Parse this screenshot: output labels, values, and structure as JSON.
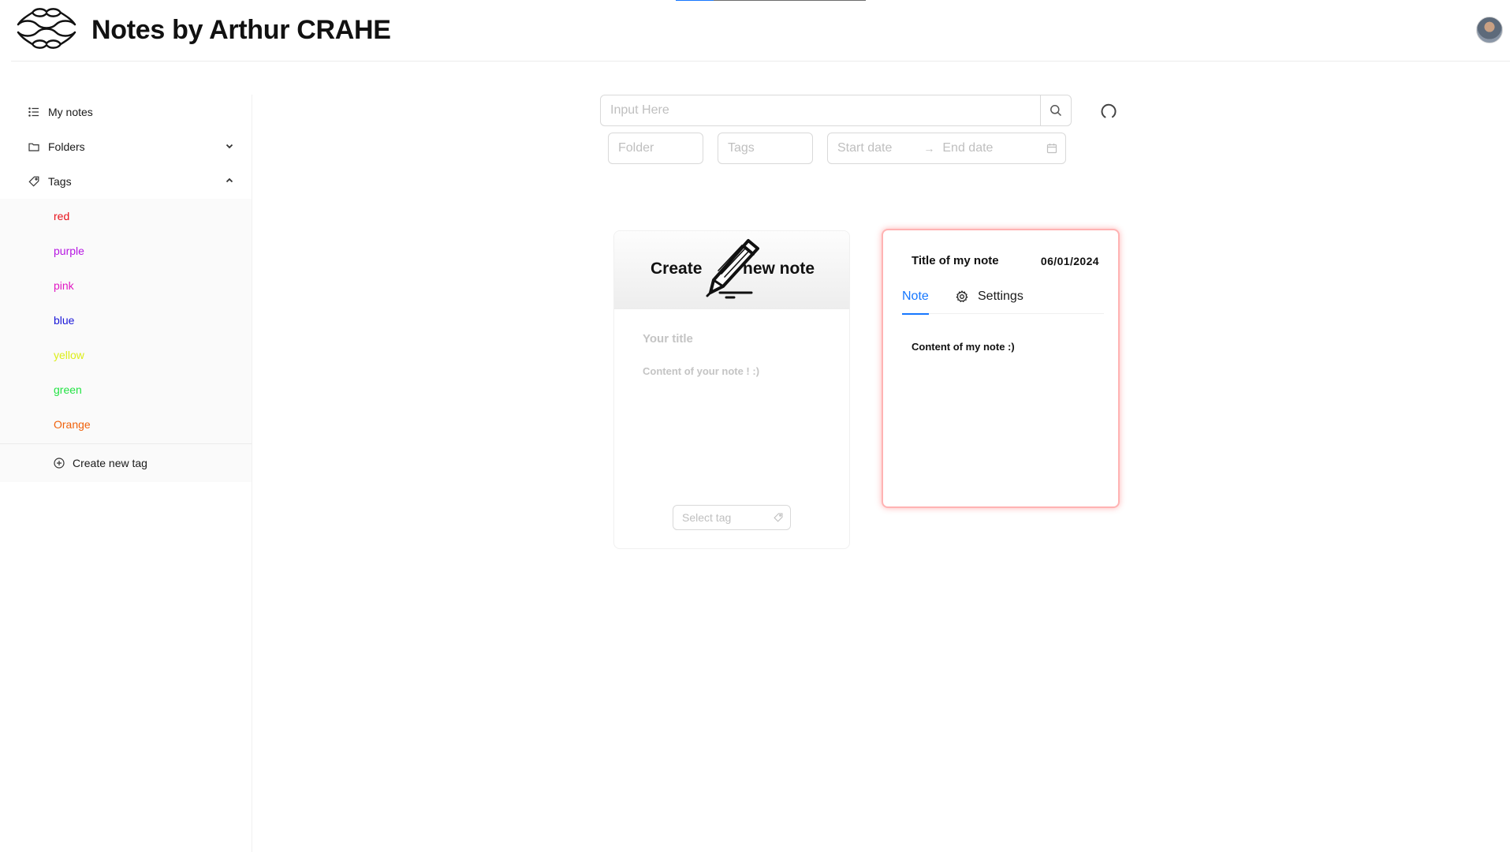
{
  "header": {
    "title": "Notes by Arthur CRAHE",
    "avatar_label": "User avatar"
  },
  "sidebar": {
    "items": [
      {
        "label": "My notes",
        "icon": "list-icon"
      },
      {
        "label": "Folders",
        "icon": "folder-icon",
        "expanded": false
      },
      {
        "label": "Tags",
        "icon": "tag-icon",
        "expanded": true
      }
    ],
    "tags": [
      {
        "label": "red",
        "color": "#e8121b"
      },
      {
        "label": "purple",
        "color": "#b617e2"
      },
      {
        "label": "pink",
        "color": "#e019c3"
      },
      {
        "label": "blue",
        "color": "#1a17d8"
      },
      {
        "label": "yellow",
        "color": "#dcee1a"
      },
      {
        "label": "green",
        "color": "#23e344"
      },
      {
        "label": "Orange",
        "color": "#f0620c"
      }
    ],
    "create_tag_label": "Create new tag"
  },
  "search": {
    "placeholder": "Input Here",
    "value": "",
    "folder_placeholder": "Folder",
    "tags_placeholder": "Tags",
    "start_date_placeholder": "Start date",
    "end_date_placeholder": "End date"
  },
  "create_card": {
    "banner_word_1": "Create",
    "banner_word_2": "new note",
    "title_placeholder": "Your title",
    "content_placeholder": "Content of your note ! :)",
    "select_tag_placeholder": "Select tag"
  },
  "note_card": {
    "title": "Title of my note",
    "date": "06/01/2024",
    "tabs": [
      {
        "label": "Note",
        "active": true
      },
      {
        "label": "Settings",
        "active": false
      }
    ],
    "content": "Content of my note :)",
    "highlight_color": "#ff8f8f"
  },
  "colors": {
    "accent": "#1677ff"
  }
}
